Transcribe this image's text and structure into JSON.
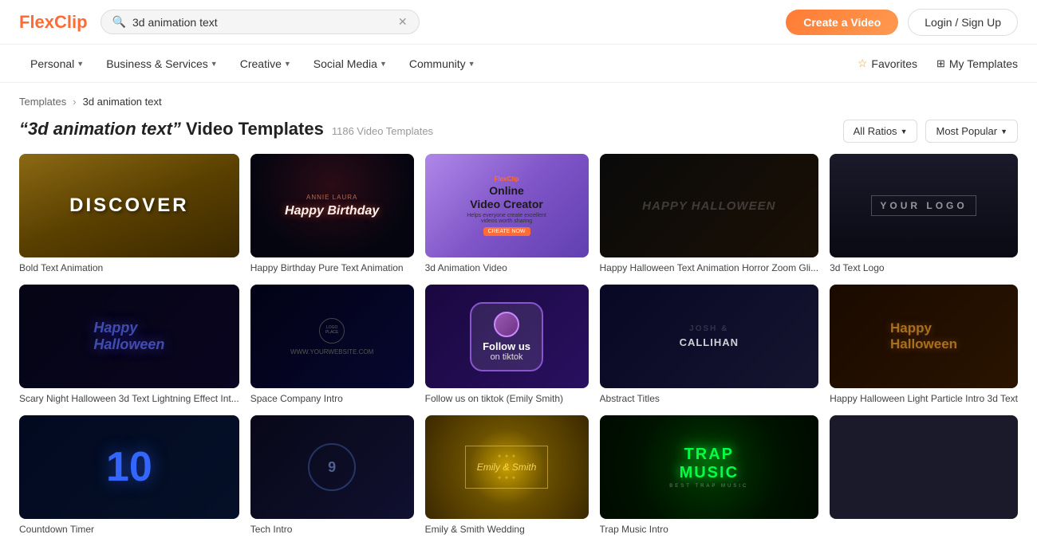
{
  "header": {
    "logo_text": "FlexClip",
    "search_value": "3d animation text",
    "create_label": "Create a Video",
    "login_label": "Login / Sign Up"
  },
  "nav": {
    "items": [
      {
        "label": "Personal",
        "has_chevron": true
      },
      {
        "label": "Business & Services",
        "has_chevron": true
      },
      {
        "label": "Creative",
        "has_chevron": true
      },
      {
        "label": "Social Media",
        "has_chevron": true
      },
      {
        "label": "Community",
        "has_chevron": true
      }
    ],
    "right_items": [
      {
        "label": "Favorites",
        "icon": "star"
      },
      {
        "label": "My Templates",
        "icon": "grid"
      }
    ]
  },
  "breadcrumb": {
    "root": "Templates",
    "current": "3d animation text"
  },
  "page": {
    "title_prefix": "\"3d animation text\"",
    "title_suffix": "Video Templates",
    "count": "1186 Video Templates",
    "filter_ratio": "All Ratios",
    "filter_sort": "Most Popular"
  },
  "templates": [
    {
      "label": "Bold Text Animation",
      "thumb": "discover"
    },
    {
      "label": "Happy Birthday Pure Text Animation",
      "thumb": "birthday"
    },
    {
      "label": "3d Animation Video",
      "thumb": "online"
    },
    {
      "label": "Happy Halloween Text Animation Horror Zoom Gli...",
      "thumb": "halloween"
    },
    {
      "label": "3d Text Logo",
      "thumb": "logo"
    },
    {
      "label": "Scary Night Halloween 3d Text Lightning Effect Int...",
      "thumb": "halloween2"
    },
    {
      "label": "Space Company Intro",
      "thumb": "space"
    },
    {
      "label": "Follow us on tiktok",
      "thumb": "follow"
    },
    {
      "label": "Abstract Titles",
      "thumb": "abstract"
    },
    {
      "label": "Happy Halloween Light Particle Intro 3d Text",
      "thumb": "halloween3"
    },
    {
      "label": "Countdown Timer",
      "thumb": "counter"
    },
    {
      "label": "Tech Intro",
      "thumb": "tech"
    },
    {
      "label": "Emily & Smith Wedding",
      "thumb": "emily"
    },
    {
      "label": "Trap Music Intro",
      "thumb": "trap"
    },
    {
      "label": "",
      "thumb": "blank"
    }
  ]
}
